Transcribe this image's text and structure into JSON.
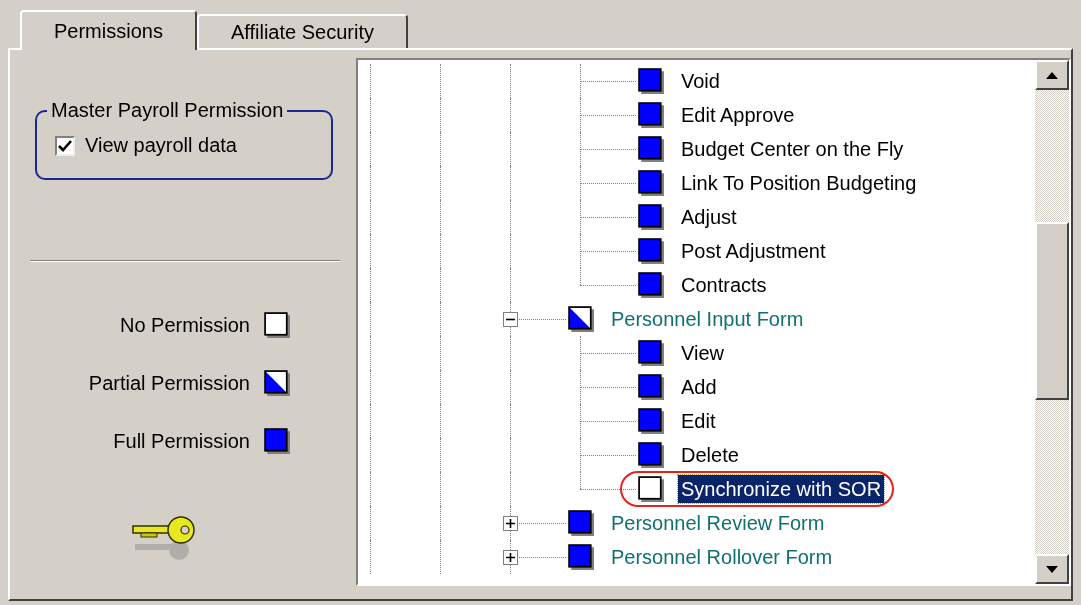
{
  "tabs": [
    {
      "label": "Permissions",
      "selected": true
    },
    {
      "label": "Affiliate Security",
      "selected": false
    }
  ],
  "master_group": {
    "title": "Master Payroll Permission",
    "checkbox": {
      "label": "View payroll data",
      "checked": true
    }
  },
  "legend": [
    {
      "label": "No Permission",
      "kind": "none"
    },
    {
      "label": "Partial Permission",
      "kind": "partial"
    },
    {
      "label": "Full Permission",
      "kind": "full"
    }
  ],
  "tree": {
    "items": [
      {
        "children": [
          {
            "children": [
              {
                "children": [
                  {
                    "label": "Void",
                    "kind": "full",
                    "selected": false
                  },
                  {
                    "label": "Edit Approve",
                    "kind": "full",
                    "selected": false
                  },
                  {
                    "label": "Budget Center on the Fly",
                    "kind": "full",
                    "selected": false
                  },
                  {
                    "label": "Link To Position Budgeting",
                    "kind": "full",
                    "selected": false
                  },
                  {
                    "label": "Adjust",
                    "kind": "full",
                    "selected": false
                  },
                  {
                    "label": "Post Adjustment",
                    "kind": "full",
                    "selected": false
                  },
                  {
                    "label": "Contracts",
                    "kind": "full",
                    "selected": false
                  }
                ]
              },
              {
                "label": "Personnel Input Form",
                "kind": "partial",
                "selected": false,
                "expanded": true,
                "children": [
                  {
                    "label": "View",
                    "kind": "full",
                    "selected": false
                  },
                  {
                    "label": "Add",
                    "kind": "full",
                    "selected": false
                  },
                  {
                    "label": "Edit",
                    "kind": "full",
                    "selected": false
                  },
                  {
                    "label": "Delete",
                    "kind": "full",
                    "selected": false
                  },
                  {
                    "label": "Synchronize with SOR",
                    "kind": "none",
                    "selected": true,
                    "circled": true
                  }
                ]
              },
              {
                "label": "Personnel Review Form",
                "kind": "full",
                "selected": false,
                "expanded": false
              },
              {
                "label": "Personnel Rollover Form",
                "kind": "full",
                "selected": false,
                "expanded": false
              }
            ]
          }
        ]
      }
    ]
  }
}
